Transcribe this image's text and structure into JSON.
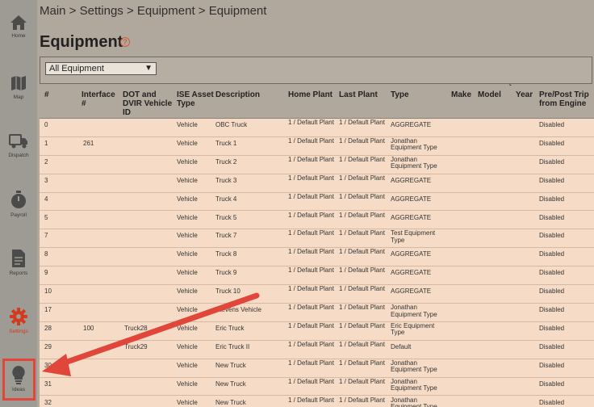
{
  "sidebar": {
    "items": [
      {
        "label": "Home",
        "icon": "home-icon"
      },
      {
        "label": "Map",
        "icon": "map-icon"
      },
      {
        "label": "Dispatch",
        "icon": "dispatch-truck-icon"
      },
      {
        "label": "Payroll",
        "icon": "stopwatch-icon"
      },
      {
        "label": "Reports",
        "icon": "document-icon"
      },
      {
        "label": "Settings",
        "icon": "gear-icon",
        "active": true
      },
      {
        "label": "Ideas",
        "icon": "lightbulb-icon",
        "highlighted": true
      }
    ]
  },
  "breadcrumb": "Main > Settings > Equipment > Equipment",
  "page": {
    "title": "Equipment",
    "help": "?"
  },
  "filter": {
    "selected": "All Equipment"
  },
  "table": {
    "headers": {
      "num": "#",
      "interface": "Interface #",
      "dot": "DOT and DVIR Vehicle ID",
      "ise": "ISE Asset Type",
      "description": "Description",
      "home_plant": "Home Plant",
      "last_plant": "Last Plant",
      "type": "Type",
      "make": "Make",
      "model": "Model",
      "year": "Year",
      "pretrip": "Pre/Post Trip from Engine"
    },
    "rows": [
      {
        "num": "0",
        "iface": "",
        "dot": "",
        "ise": "Vehicle",
        "desc": "OBC Truck",
        "hp": "1 / Default Plant",
        "lp": "1 / Default Plant",
        "type": "AGGREGATE",
        "pre": "Disabled"
      },
      {
        "num": "1",
        "iface": "261",
        "dot": "",
        "ise": "Vehicle",
        "desc": "Truck 1",
        "hp": "1 / Default Plant",
        "lp": "1 / Default Plant",
        "type": "Jonathan Equipment Type",
        "pre": "Disabled"
      },
      {
        "num": "2",
        "iface": "",
        "dot": "",
        "ise": "Vehicle",
        "desc": "Truck 2",
        "hp": "1 / Default Plant",
        "lp": "1 / Default Plant",
        "type": "Jonathan Equipment Type",
        "pre": "Disabled"
      },
      {
        "num": "3",
        "iface": "",
        "dot": "",
        "ise": "Vehicle",
        "desc": "Truck 3",
        "hp": "1 / Default Plant",
        "lp": "1 / Default Plant",
        "type": "AGGREGATE",
        "pre": "Disabled"
      },
      {
        "num": "4",
        "iface": "",
        "dot": "",
        "ise": "Vehicle",
        "desc": "Truck 4",
        "hp": "1 / Default Plant",
        "lp": "1 / Default Plant",
        "type": "AGGREGATE",
        "pre": "Disabled"
      },
      {
        "num": "5",
        "iface": "",
        "dot": "",
        "ise": "Vehicle",
        "desc": "Truck 5",
        "hp": "1 / Default Plant",
        "lp": "1 / Default Plant",
        "type": "AGGREGATE",
        "pre": "Disabled"
      },
      {
        "num": "7",
        "iface": "",
        "dot": "",
        "ise": "Vehicle",
        "desc": "Truck 7",
        "hp": "1 / Default Plant",
        "lp": "1 / Default Plant",
        "type": "Test Equipment Type",
        "pre": "Disabled"
      },
      {
        "num": "8",
        "iface": "",
        "dot": "",
        "ise": "Vehicle",
        "desc": "Truck 8",
        "hp": "1 / Default Plant",
        "lp": "1 / Default Plant",
        "type": "AGGREGATE",
        "pre": "Disabled"
      },
      {
        "num": "9",
        "iface": "",
        "dot": "",
        "ise": "Vehicle",
        "desc": "Truck 9",
        "hp": "1 / Default Plant",
        "lp": "1 / Default Plant",
        "type": "AGGREGATE",
        "pre": "Disabled"
      },
      {
        "num": "10",
        "iface": "",
        "dot": "",
        "ise": "Vehicle",
        "desc": "Truck 10",
        "hp": "1 / Default Plant",
        "lp": "1 / Default Plant",
        "type": "AGGREGATE",
        "pre": "Disabled"
      },
      {
        "num": "17",
        "iface": "",
        "dot": "",
        "ise": "Vehicle",
        "desc": "Stevens Vehicle",
        "hp": "1 / Default Plant",
        "lp": "1 / Default Plant",
        "type": "Jonathan Equipment Type",
        "pre": "Disabled"
      },
      {
        "num": "28",
        "iface": "100",
        "dot": "Truck28",
        "ise": "Vehicle",
        "desc": "Eric Truck",
        "hp": "1 / Default Plant",
        "lp": "1 / Default Plant",
        "type": "Eric Equipment Type",
        "pre": "Disabled"
      },
      {
        "num": "29",
        "iface": "",
        "dot": "Truck29",
        "ise": "Vehicle",
        "desc": "Eric Truck II",
        "hp": "1 / Default Plant",
        "lp": "1 / Default Plant",
        "type": "Default",
        "pre": "Disabled"
      },
      {
        "num": "30",
        "iface": "",
        "dot": "",
        "ise": "Vehicle",
        "desc": "New Truck",
        "hp": "1 / Default Plant",
        "lp": "1 / Default Plant",
        "type": "Jonathan Equipment Type",
        "pre": "Disabled"
      },
      {
        "num": "31",
        "iface": "",
        "dot": "",
        "ise": "Vehicle",
        "desc": "New Truck",
        "hp": "1 / Default Plant",
        "lp": "1 / Default Plant",
        "type": "Jonathan Equipment Type",
        "pre": "Disabled"
      },
      {
        "num": "32",
        "iface": "",
        "dot": "",
        "ise": "Vehicle",
        "desc": "New Truck",
        "hp": "1 / Default Plant",
        "lp": "1 / Default Plant",
        "type": "Jonathan Equipment Type",
        "pre": "Disabled"
      }
    ]
  },
  "colors": {
    "accent": "#d33a1f",
    "highlight_box": "#e0463a",
    "arrow": "#e0463a"
  }
}
